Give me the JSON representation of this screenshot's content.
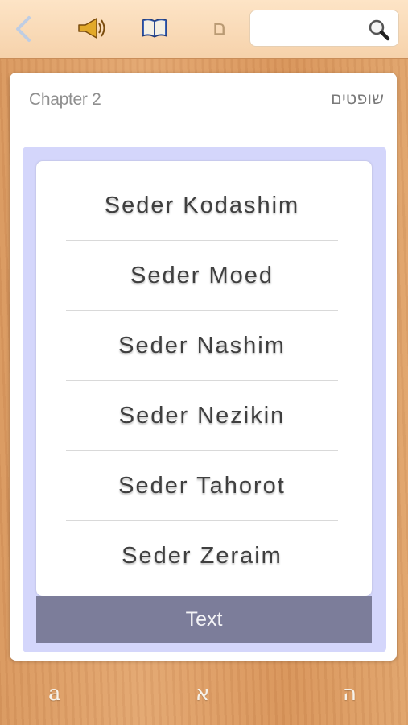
{
  "toolbar": {
    "icons": [
      "back-chevron-icon",
      "speaker-icon",
      "open-book-icon",
      "hebrew-letter-icon"
    ],
    "hebrew_letter": "ם",
    "search": {
      "placeholder": "",
      "value": ""
    }
  },
  "card": {
    "hebrew_title": "שופטים",
    "chapter_title": "Chapter 2"
  },
  "picker": {
    "items": [
      {
        "label": "Seder Kodashim"
      },
      {
        "label": "Seder Moed"
      },
      {
        "label": "Seder Nashim"
      },
      {
        "label": "Seder Nezikin"
      },
      {
        "label": "Seder Tahorot"
      },
      {
        "label": "Seder Zeraim"
      }
    ],
    "button_label": "Text"
  },
  "bottom_tabs": [
    "a",
    "א",
    "ה"
  ],
  "colors": {
    "toolbar_bg": "#f9dbb9",
    "overlay": "#d4d6fb",
    "button_bg": "#7c7d9a",
    "chevron": "#bfcde3"
  }
}
